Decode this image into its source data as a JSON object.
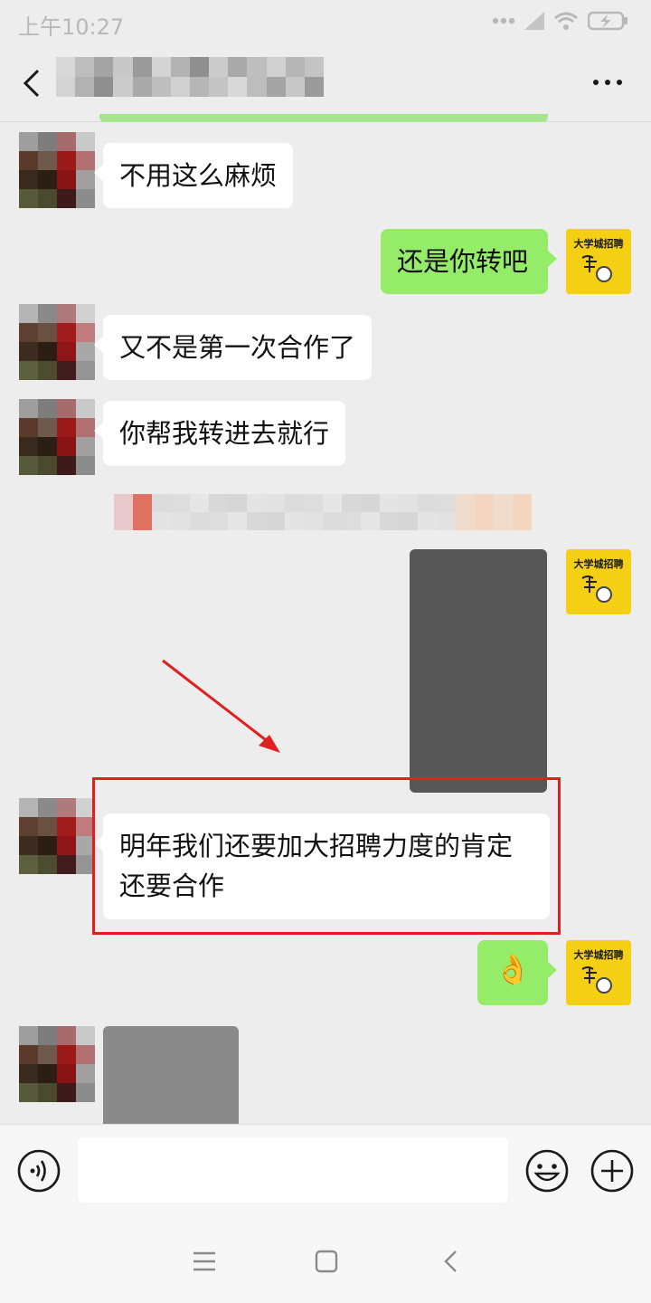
{
  "status_bar": {
    "time": "上午10:27",
    "battery_icon": "battery-charging-icon",
    "wifi_icon": "wifi-icon",
    "signal_icon": "signal-icon"
  },
  "nav": {
    "back_icon": "chevron-left-icon",
    "more_icon": "more-dots-icon"
  },
  "messages": [
    {
      "side": "left",
      "text": "不用这么麻烦"
    },
    {
      "side": "right",
      "text": "还是你转吧"
    },
    {
      "side": "left",
      "text": "又不是第一次合作了"
    },
    {
      "side": "left",
      "text": "你帮我转进去就行"
    },
    {
      "side": "left",
      "text": "明年我们还要加大招聘力度的肯定",
      "text2": "还要合作"
    },
    {
      "side": "right",
      "text": "👌"
    }
  ],
  "avatar_right": {
    "logo_text": "大学城招聘"
  },
  "input_bar": {
    "placeholder": "",
    "voice_icon": "voice-icon",
    "emoji_icon": "emoji-icon",
    "plus_icon": "plus-icon"
  },
  "system_nav": {
    "menu_icon": "menu-icon",
    "home_icon": "home-icon",
    "back_icon": "back-icon"
  },
  "colors": {
    "sent_bubble": "#95ec69",
    "received_bubble": "#ffffff",
    "highlight": "#e02020",
    "avatar_bg": "#f4cf14"
  }
}
